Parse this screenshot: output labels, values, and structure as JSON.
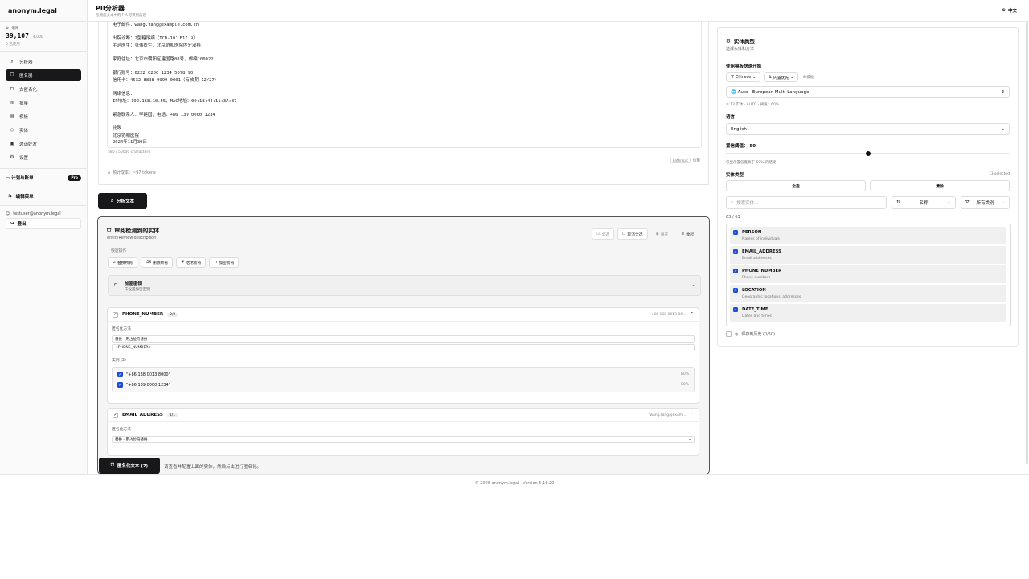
{
  "app": {
    "name": "anonym.legal"
  },
  "credits": {
    "label": "令牌",
    "value": "39,107",
    "total": "/ 4,000",
    "used": "0 已使用"
  },
  "sidebar": {
    "items": [
      {
        "label": "分析器",
        "icon": "search-icon"
      },
      {
        "label": "匿名器",
        "icon": "shield-icon"
      },
      {
        "label": "去匿名化",
        "icon": "unlock-icon"
      },
      {
        "label": "批量",
        "icon": "layers-icon"
      },
      {
        "label": "模板",
        "icon": "file-icon"
      },
      {
        "label": "实体",
        "icon": "tag-icon"
      },
      {
        "label": "邀请好友",
        "icon": "gift-icon"
      },
      {
        "label": "设置",
        "icon": "gear-icon"
      }
    ],
    "active_index": 1,
    "plan_label": "计划与账单",
    "plan_badge": "Pro",
    "edit_menu": "编辑菜单",
    "user_email": "testuser@anonym.legal",
    "logout": "登出"
  },
  "header": {
    "title": "PII分析器",
    "subtitle": "检测您文本中的个人可识别信息",
    "language": "中文"
  },
  "editor": {
    "text": "电子邮件：wang.fang@example.com.cn\n\n出院诊断：2型糖尿病（ICD-10：E11.9）\n主治医生：张伟医生，北京协和医院内分泌科\n\n家庭住址：北京市朝阳区建国路88号，邮编100022\n\n银行账号：6222 0200 1234 5678 90\n信用卡：4532-8888-9999-0001（有效期 12/27）\n\n网络信息：\nIP地址：192.168.10.55，MAC地址：00:1B:44:11:3A:B7\n\n紧急联系人：李建国，电话：+86 139 0000 1234\n\n此致\n北京协和医院\n2024年11月30日",
    "char_count": "580 / 50000 characters",
    "tokens": "预计成本：~97 tokens",
    "tokenizer_tag": "Anthropic",
    "tokenizer_label": "估算",
    "analyze_button": "分析文本"
  },
  "review": {
    "title": "审阅检测到的实体",
    "description": "entityReview.description",
    "tools": {
      "select_all": "全选",
      "deselect_all": "取消全选",
      "expand": "展开",
      "collapse": "收起"
    },
    "quick_label": "快速操作",
    "quick_actions": [
      "替换所有",
      "删除所有",
      "哈希所有",
      "加密所有"
    ],
    "encrypt_title": "加密密钥",
    "encrypt_sub": "未设置加密密钥",
    "entities": [
      {
        "name": "PHONE_NUMBER",
        "count": "2/2",
        "preview": "\"+86 138 0013 80...",
        "method_label": "匿名化方法",
        "method": "替换 - 用占位符替换",
        "replacement": "<PHONE_NUMBER>",
        "instances_label": "实例 (2)",
        "instances": [
          {
            "text": "\"+86 138 0013 8000\"",
            "score": "80%"
          },
          {
            "text": "\"+86 139 0000 1234\"",
            "score": "80%"
          }
        ]
      },
      {
        "name": "EMAIL_ADDRESS",
        "count": "1/1",
        "preview": "\"wang.fang@exam...",
        "method_label": "匿名化方法",
        "method": "替换 - 用占位符替换"
      }
    ],
    "anonymize_button": "匿名化文本 (7)",
    "note": "请查看并配置上面的实体，然后点击进行匿名化。"
  },
  "entity_panel": {
    "title": "实体类型",
    "subtitle": "选择实体和方法",
    "template_label": "使用模板快速开始",
    "chip_language": "Chinese",
    "chip_builtin": "内置优先",
    "chip_count": "8 模板",
    "template_value": "Auto - European Multi-Language",
    "template_meta": "13 实体 · AUTO · 阈值：60%",
    "language_label": "语言",
    "language_value": "English",
    "threshold_label": "置信阈值：",
    "threshold_value": "50",
    "threshold_fraction": 0.5,
    "threshold_hint": "仅显示置信度高于 50% 的结果",
    "types_label": "实体类型",
    "types_selected": "13 selected",
    "select_all": "全选",
    "clear": "清除",
    "search_placeholder": "搜索实体...",
    "sort_label": "名称",
    "filter_label": "所有类别",
    "count": "63 / 63",
    "types": [
      {
        "name": "PERSON",
        "desc": "Names of individuals"
      },
      {
        "name": "EMAIL_ADDRESS",
        "desc": "Email addresses"
      },
      {
        "name": "PHONE_NUMBER",
        "desc": "Phone numbers"
      },
      {
        "name": "LOCATION",
        "desc": "Geographic locations, addresses"
      },
      {
        "name": "DATE_TIME",
        "desc": "Dates and times"
      }
    ],
    "history": "保存到历史 (0/50)"
  },
  "footer": {
    "copyright": "© 2026 anonym.legal · Version 5.16.20"
  }
}
